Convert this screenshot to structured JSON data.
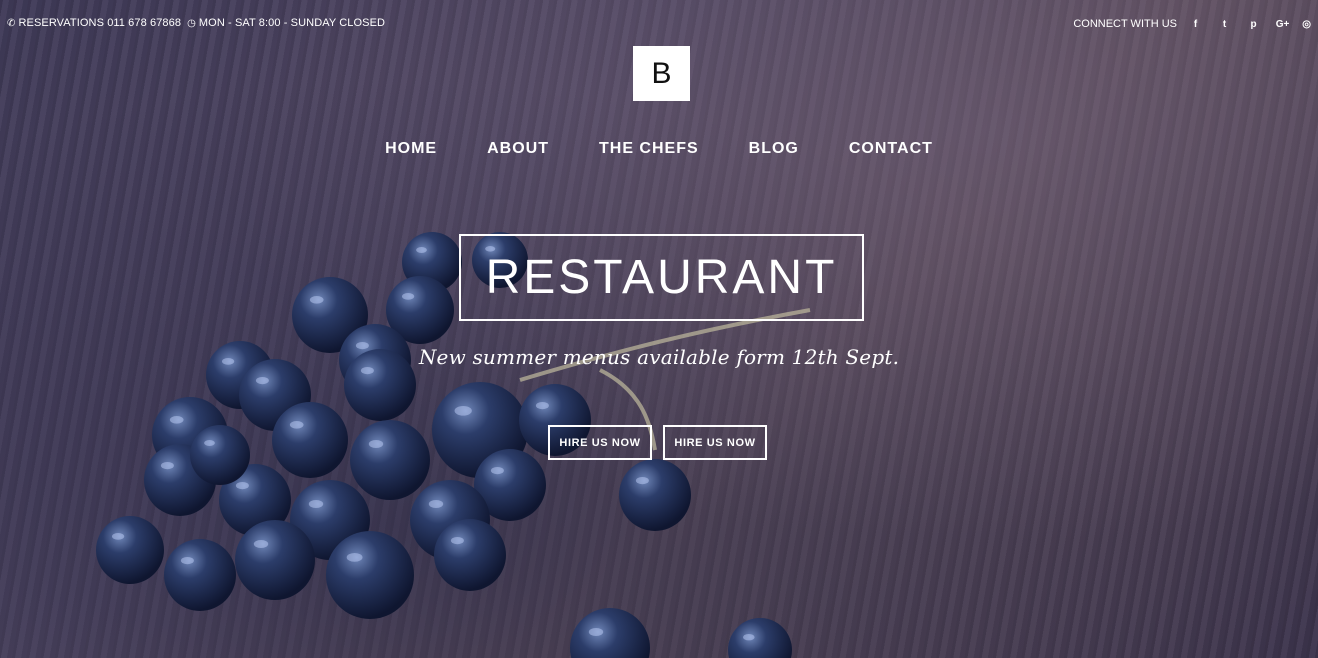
{
  "topbar": {
    "phone_icon": "phone-icon",
    "reservations": "RESERVATIONS 011 678 67868",
    "clock_icon": "clock-icon",
    "hours": "MON - SAT 8:00 - SUNDAY CLOSED",
    "connect": "CONNECT WITH US",
    "social": [
      {
        "name": "facebook-icon",
        "glyph": "f"
      },
      {
        "name": "twitter-icon",
        "glyph": "t"
      },
      {
        "name": "pinterest-icon",
        "glyph": "p"
      },
      {
        "name": "google-plus-icon",
        "glyph": "G+"
      },
      {
        "name": "instagram-icon",
        "glyph": "◎"
      }
    ]
  },
  "logo": {
    "letter": "B"
  },
  "nav": {
    "items": [
      "HOME",
      "ABOUT",
      "THE CHEFS",
      "BLOG",
      "CONTACT"
    ]
  },
  "hero": {
    "title": "RESTAURANT",
    "tagline": "New summer menus available form 12th Sept.",
    "buttons": [
      "HIRE US NOW",
      "HIRE US NOW"
    ]
  },
  "colors": {
    "overlay": "#3f3a58",
    "berry": "#1e2c4f",
    "text": "#ffffff"
  }
}
